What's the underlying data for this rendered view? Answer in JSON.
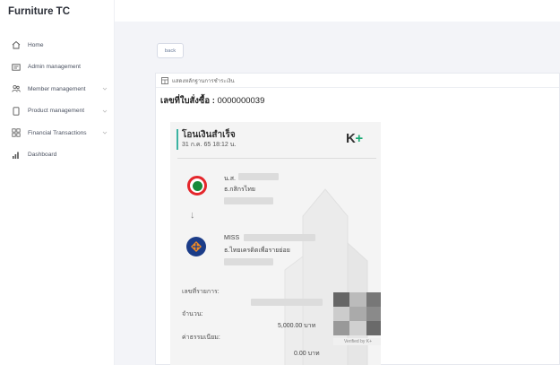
{
  "app": {
    "brand": "Furniture TC"
  },
  "sidebar": {
    "items": [
      {
        "label": "Home",
        "icon": "home-icon",
        "has_chevron": false
      },
      {
        "label": "Admin management",
        "icon": "admin-card-icon",
        "has_chevron": false
      },
      {
        "label": "Member management",
        "icon": "members-icon",
        "has_chevron": true
      },
      {
        "label": "Product management",
        "icon": "product-icon",
        "has_chevron": true
      },
      {
        "label": "Financial Transactions",
        "icon": "grid-icon",
        "has_chevron": true
      },
      {
        "label": "Dashboard",
        "icon": "bar-chart-icon",
        "has_chevron": false
      }
    ]
  },
  "main": {
    "back_label": "back",
    "card_title": "แสดงหลักฐานการชำระเงิน",
    "order_label": "เลขที่ใบสั่งซื้อ :",
    "order_number": "0000000039"
  },
  "slip": {
    "status": "โอนเงินสำเร็จ",
    "datetime": "31 ก.ค. 65  18:12 น.",
    "logo_main": "K",
    "logo_plus": "+",
    "sender_name_prefix": "น.ส.",
    "sender_bank": "ธ.กสิกรไทย",
    "receiver_name_prefix": "MISS",
    "receiver_bank": "ธ.ไทยเครดิตเพื่อรายย่อย",
    "ref_label": "เลขที่รายการ:",
    "amount_label": "จำนวน:",
    "amount_value": "5,000.00 บาท",
    "fee_label": "ค่าธรรมเนียม:",
    "fee_value": "0.00 บาท",
    "verified": "Verified by K+",
    "accent_color": "#3bb3a2",
    "kbank_color": "#178a3a"
  }
}
